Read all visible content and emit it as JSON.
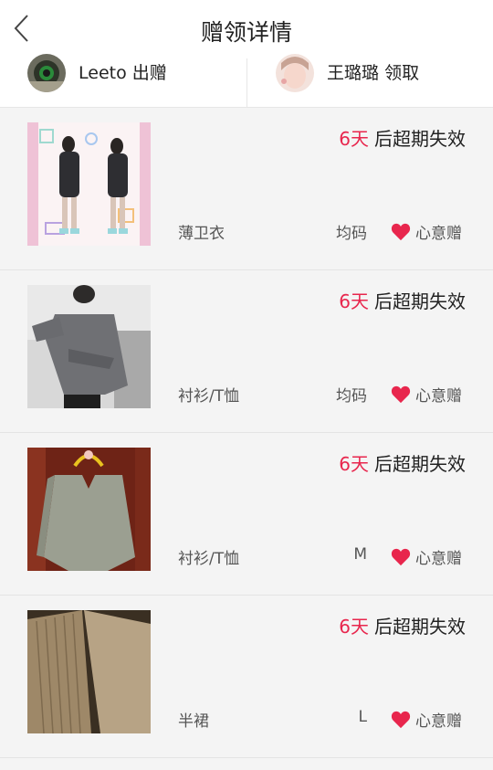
{
  "header": {
    "title": "赠领详情",
    "back_icon": "chevron-left-icon"
  },
  "users": {
    "giver": {
      "name": "Leeto",
      "action": "出赠"
    },
    "receiver": {
      "name": "王璐璐",
      "action": "领取"
    }
  },
  "items": [
    {
      "expiry_days": "6天",
      "expiry_suffix": "后超期失效",
      "category": "薄卫衣",
      "size": "均码",
      "gift_label": "心意赠"
    },
    {
      "expiry_days": "6天",
      "expiry_suffix": "后超期失效",
      "category": "衬衫/T恤",
      "size": "均码",
      "gift_label": "心意赠"
    },
    {
      "expiry_days": "6天",
      "expiry_suffix": "后超期失效",
      "category": "衬衫/T恤",
      "size": "M",
      "gift_label": "心意赠"
    },
    {
      "expiry_days": "6天",
      "expiry_suffix": "后超期失效",
      "category": "半裙",
      "size": "L",
      "gift_label": "心意赠"
    }
  ],
  "colors": {
    "accent": "#e8264d",
    "background": "#f4f4f4"
  }
}
